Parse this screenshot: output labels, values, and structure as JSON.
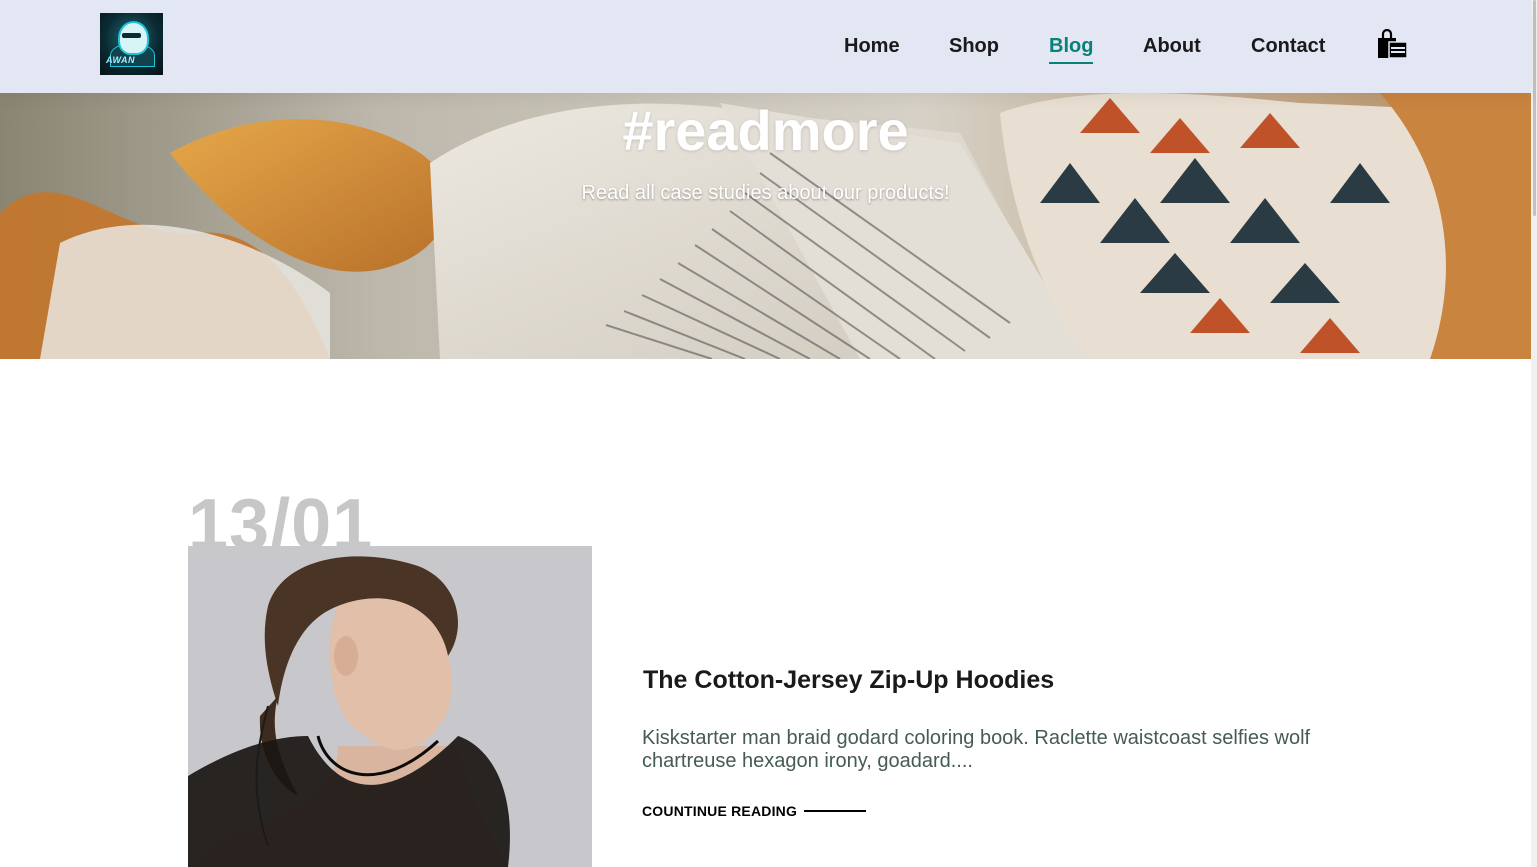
{
  "header": {
    "logo_text": "AWAN",
    "nav": [
      {
        "label": "Home",
        "active": false
      },
      {
        "label": "Shop",
        "active": false
      },
      {
        "label": "Blog",
        "active": true
      },
      {
        "label": "About",
        "active": false
      },
      {
        "label": "Contact",
        "active": false
      }
    ],
    "cart_icon": "shopping-bag-icon",
    "accent_color": "#088178",
    "background_color": "#e3e6f3"
  },
  "hero": {
    "title": "#readmore",
    "subtitle": "Read all case studies about our products!"
  },
  "blog": {
    "posts": [
      {
        "date": "13/01",
        "title": "The Cotton-Jersey Zip-Up Hoodies",
        "excerpt": "Kiskstarter man braid godard coloring book. Raclette waistcoast selfies wolf chartreuse hexagon irony, goadard....",
        "read_more_label": "COUNTINUE READING"
      }
    ]
  }
}
